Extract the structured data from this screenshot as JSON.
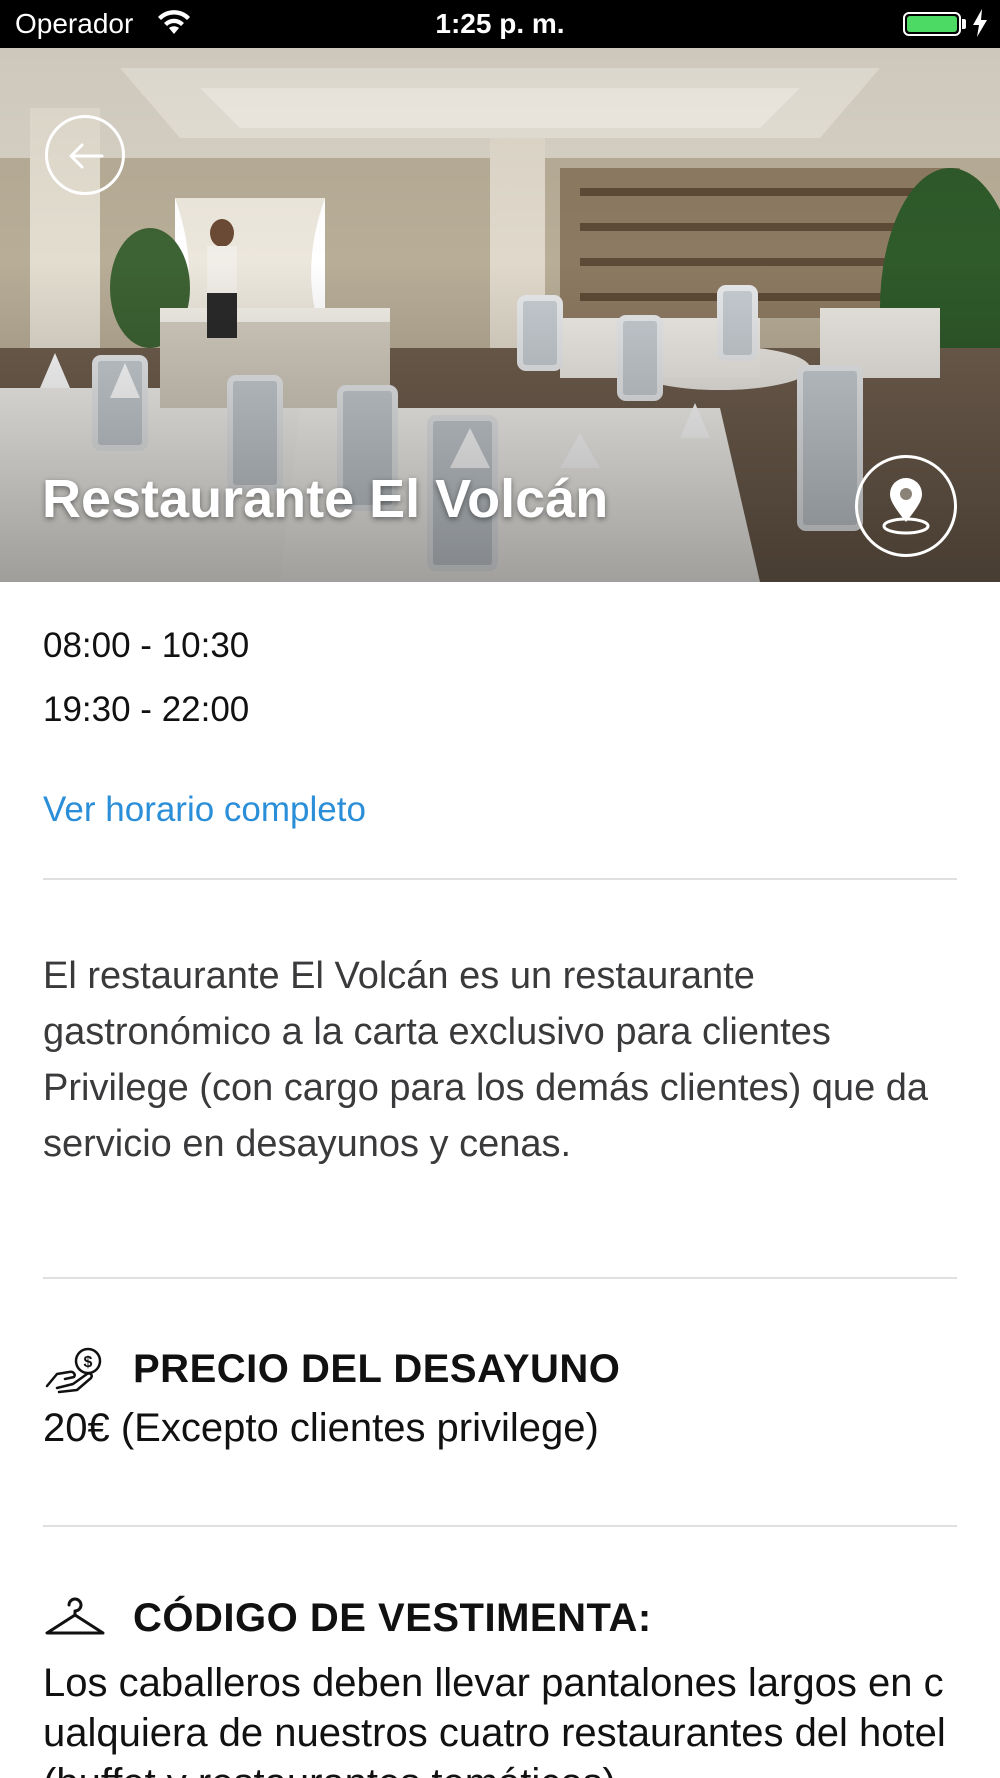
{
  "status_bar": {
    "carrier": "Operador",
    "time": "1:25 p. m.",
    "battery_level": 1.0,
    "battery_color": "#4cd964"
  },
  "hero": {
    "title": "Restaurante El Volcán",
    "back_icon": "arrow-left-icon",
    "map_icon": "map-pin-icon"
  },
  "hours": [
    "08:00 - 10:30",
    "19:30 - 22:00"
  ],
  "schedule_link": "Ver horario completo",
  "link_color": "#2a8fd8",
  "description": "El restaurante El Volcán es un restaurante gastronómico a la carta exclusivo para clientes Privilege (con cargo para los demás clientes) que da servicio en desayunos y cenas.",
  "price": {
    "icon": "money-hand-icon",
    "heading": "PRECIO DEL DESAYUNO",
    "value": "20€ (Excepto clientes privilege)"
  },
  "dress_code": {
    "icon": "hanger-icon",
    "heading": "CÓDIGO DE VESTIMENTA:",
    "text": "Los caballeros deben llevar pantalones largos en cualquiera de nuestros cuatro restaurantes del hotel (buffet y restaurantes temáticos)."
  }
}
